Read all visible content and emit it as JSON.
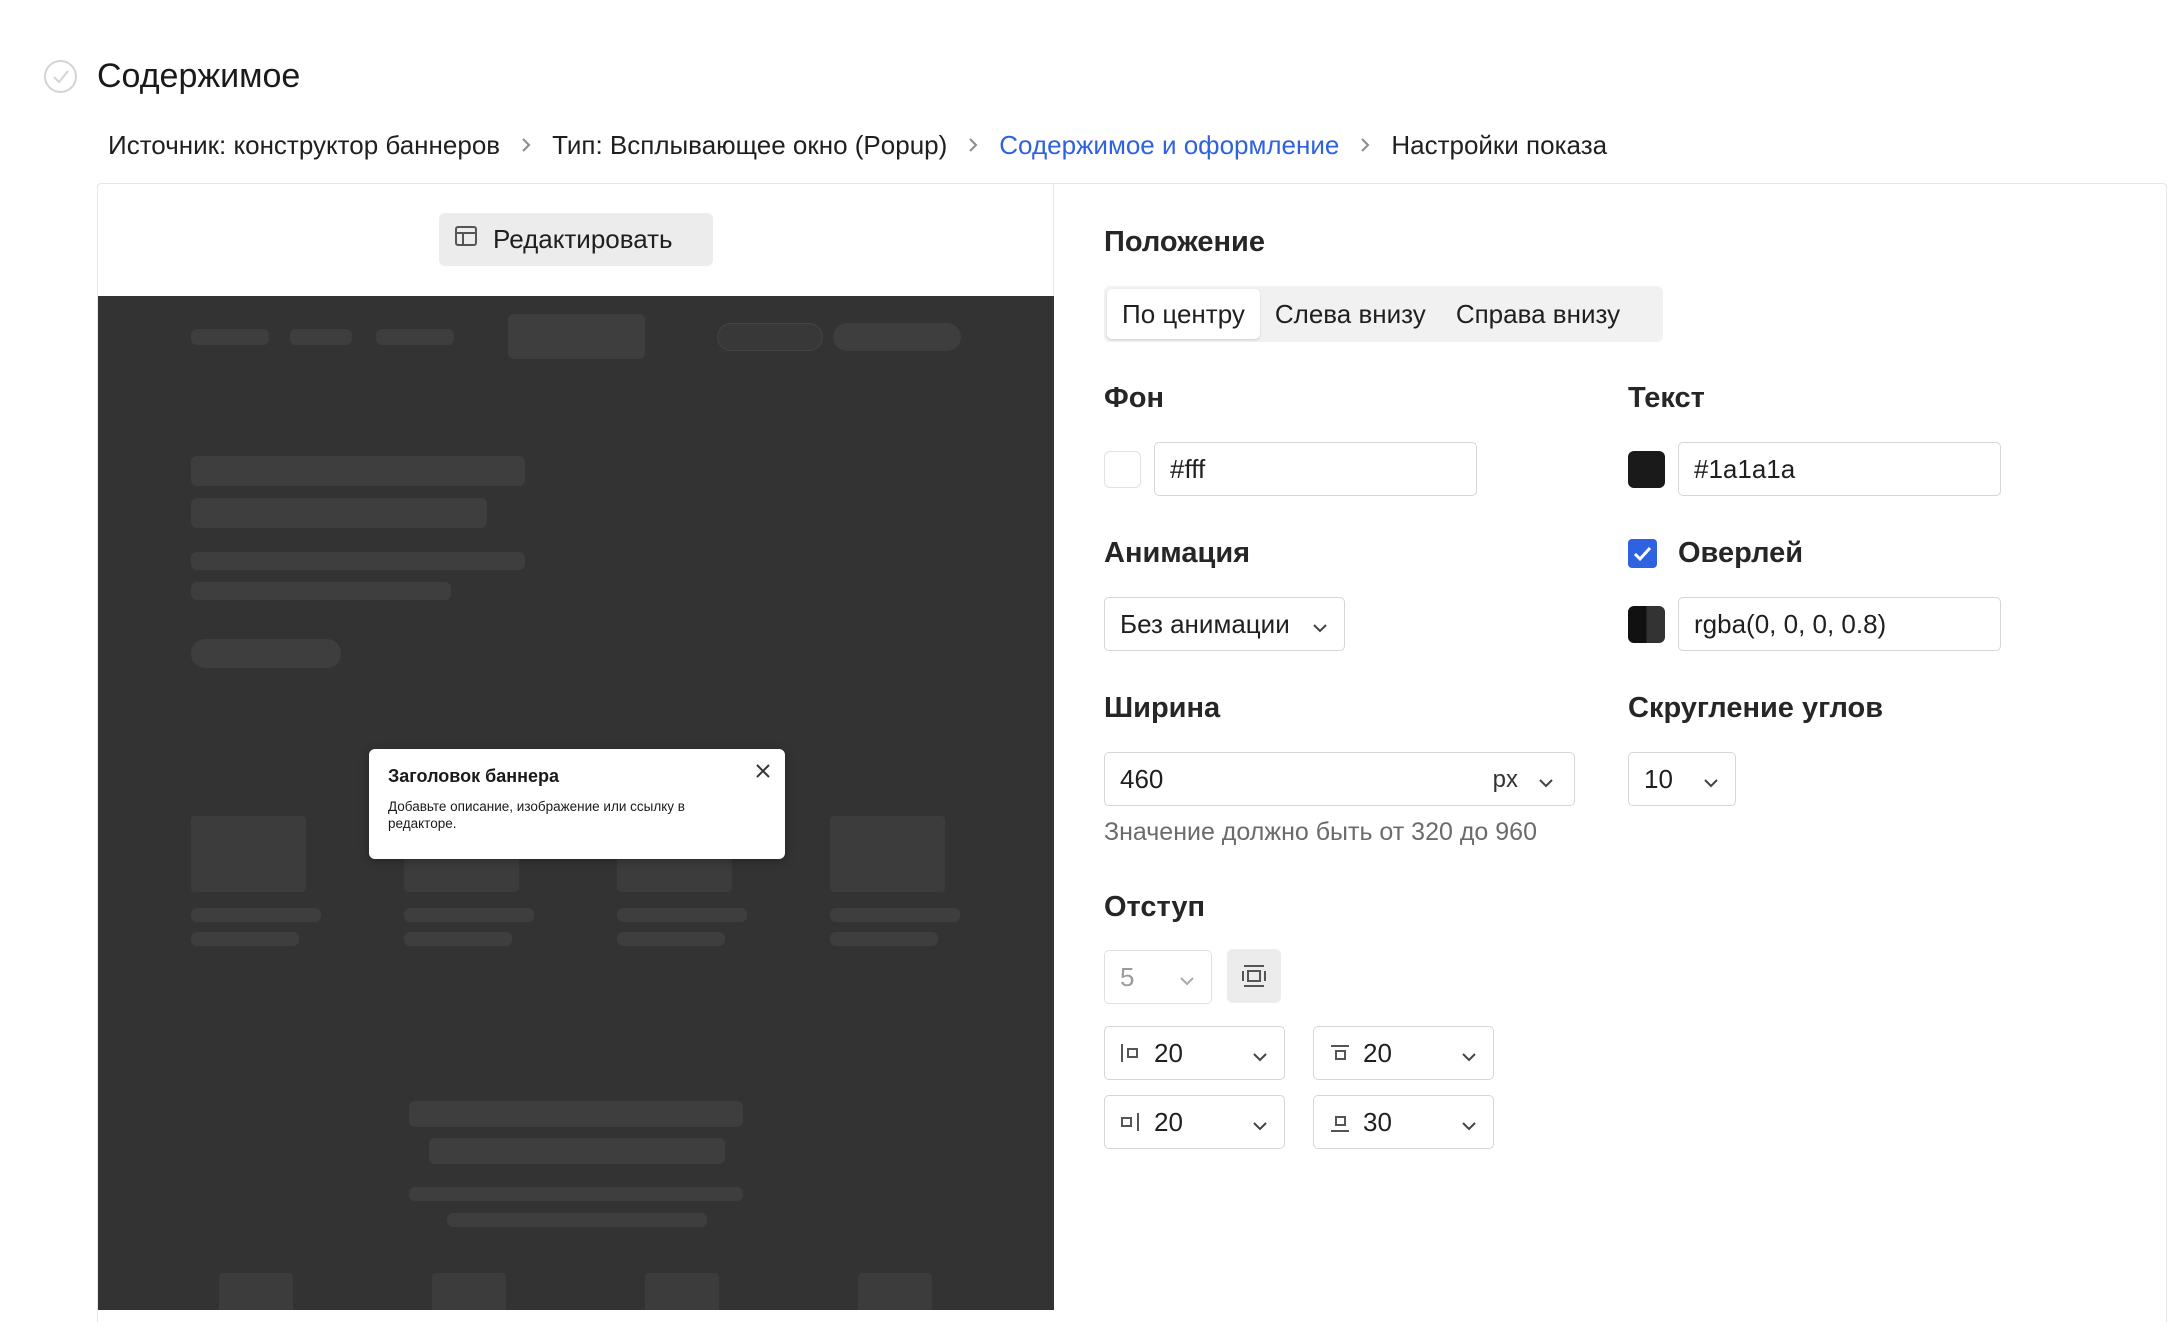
{
  "header": {
    "title": "Содержимое"
  },
  "breadcrumb": [
    {
      "label": "Источник: конструктор баннеров",
      "active": false
    },
    {
      "label": "Тип: Всплывающее окно (Popup)",
      "active": false
    },
    {
      "label": "Содержимое и оформление",
      "active": true
    },
    {
      "label": "Настройки показа",
      "active": false
    }
  ],
  "preview": {
    "edit_label": "Редактировать",
    "popup_title": "Заголовок баннера",
    "popup_desc": "Добавьте описание, изображение или ссылку в редакторе."
  },
  "settings": {
    "position": {
      "label": "Положение",
      "options": [
        "По центру",
        "Слева внизу",
        "Справа внизу"
      ],
      "selected": "По центру"
    },
    "background": {
      "label": "Фон",
      "value": "#fff",
      "color": "#ffffff"
    },
    "text": {
      "label": "Текст",
      "value": "#1a1a1a",
      "color": "#1a1a1a"
    },
    "animation": {
      "label": "Анимация",
      "value": "Без анимации"
    },
    "overlay": {
      "label": "Оверлей",
      "checked": true,
      "value": "rgba(0, 0, 0, 0.8)"
    },
    "width": {
      "label": "Ширина",
      "value": "460",
      "unit": "px",
      "hint": "Значение должно быть от 320 до 960"
    },
    "radius": {
      "label": "Скругление углов",
      "value": "10"
    },
    "padding": {
      "label": "Отступ",
      "all": "5",
      "left": "20",
      "top": "20",
      "right": "20",
      "bottom": "30"
    }
  },
  "colors": {
    "accent": "#2f62e0",
    "preview_bg": "#333333",
    "border": "#d6d6d6"
  }
}
